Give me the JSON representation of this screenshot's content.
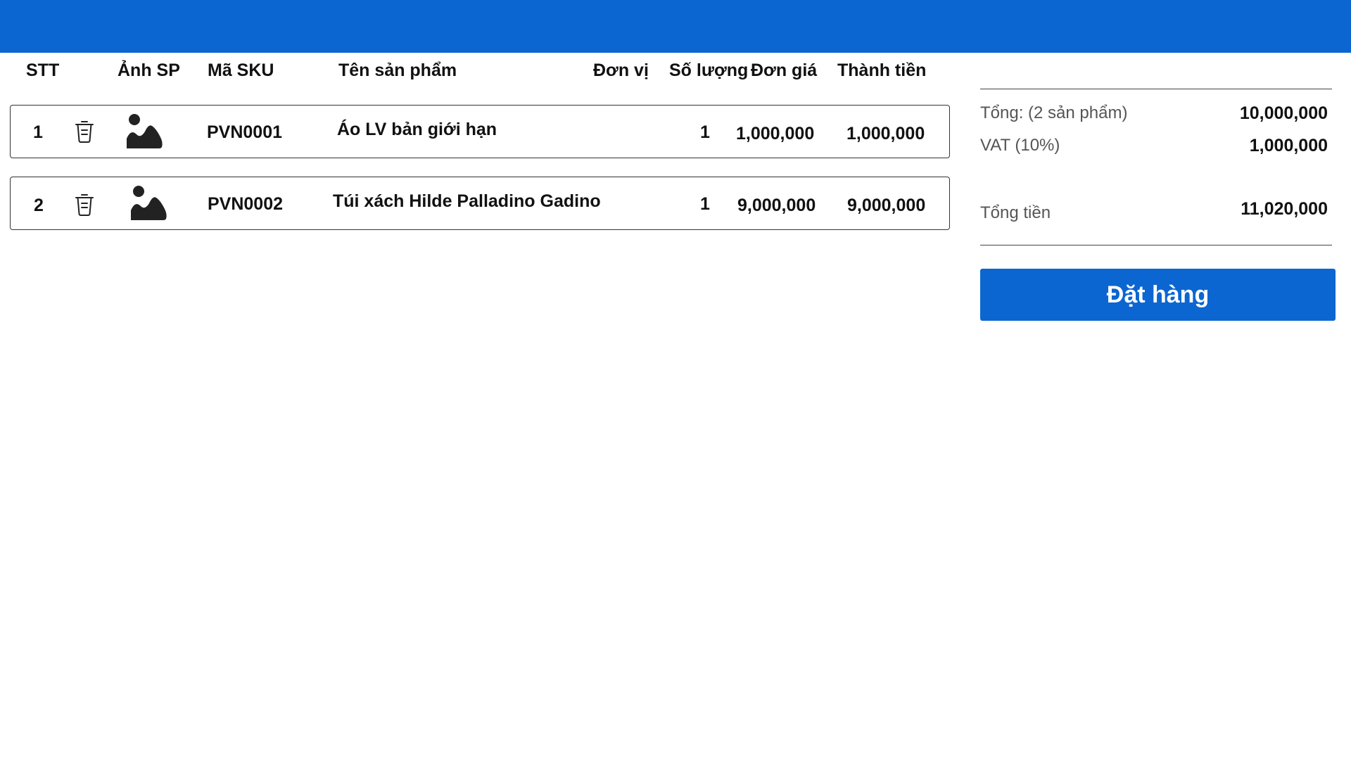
{
  "table": {
    "headers": {
      "index": "STT",
      "image": "Ảnh SP",
      "sku": "Mã SKU",
      "name": "Tên sản phẩm",
      "unit": "Đơn vị",
      "quantity": "Số lượng",
      "price": "Đơn giá",
      "total": "Thành tiền"
    },
    "rows": [
      {
        "index": "1",
        "sku": "PVN0001",
        "name": "Áo LV bản giới hạn",
        "unit": "",
        "quantity": "1",
        "price": "1,000,000",
        "total": "1,000,000",
        "delete_icon": "trash-icon",
        "image_icon": "image-placeholder-icon"
      },
      {
        "index": "2",
        "sku": "PVN0002",
        "name": "Túi xách Hilde Palladino Gadino",
        "unit": "",
        "quantity": "1",
        "price": "9,000,000",
        "total": "9,000,000",
        "delete_icon": "trash-icon",
        "image_icon": "image-placeholder-icon"
      }
    ]
  },
  "summary": {
    "subtotal_label": "Tổng: (2 sản phẩm)",
    "subtotal_value": "10,000,000",
    "vat_label": "VAT (10%)",
    "vat_value": "1,000,000",
    "total_label": "Tổng tiền",
    "total_value": "11,020,000"
  },
  "actions": {
    "order_label": "Đặt hàng"
  },
  "colors": {
    "brand": "#0b66d1",
    "text": "#111111",
    "muted": "#555555"
  }
}
